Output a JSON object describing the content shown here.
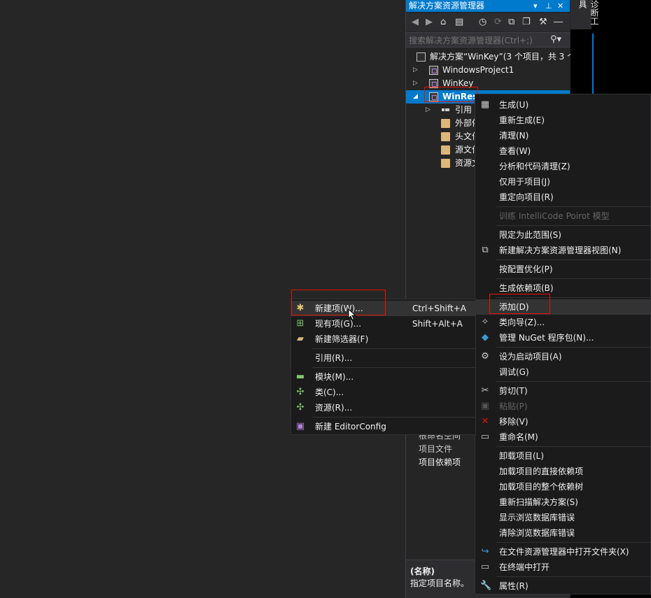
{
  "solution_explorer": {
    "title": "解决方案资源管理器",
    "title_controls": [
      "▾",
      "⊥",
      "✕"
    ],
    "search_placeholder": "搜索解决方案资源管理器(Ctrl+;)",
    "tree": {
      "solution": "解决方案“WinKey”(3 个项目，共 3 个",
      "project1": "WindowsProject1",
      "project2": "WinKey",
      "project3": "WinRes",
      "children": [
        "引用",
        "外部依",
        "头文件",
        "源文件",
        "资源文"
      ]
    },
    "properties": {
      "rows": [
        "根命名空间",
        "项目文件",
        "项目依赖项"
      ],
      "desc_title": "(名称)",
      "desc_text": "指定项目名称。"
    }
  },
  "side_tab": "诊断工具",
  "context_menu": {
    "items": [
      {
        "label": "生成(U)",
        "icon": "build-icon"
      },
      {
        "label": "重新生成(E)"
      },
      {
        "label": "清理(N)"
      },
      {
        "label": "查看(W)"
      },
      {
        "label": "分析和代码清理(Z)"
      },
      {
        "label": "仅用于项目(J)"
      },
      {
        "label": "重定向项目(R)"
      },
      {
        "label": "训练 IntelliCode Poirot 模型",
        "disabled": true
      },
      {
        "label": "限定为此范围(S)"
      },
      {
        "label": "新建解决方案资源管理器视图(N)",
        "icon": "new-view-icon"
      },
      {
        "label": "按配置优化(P)"
      },
      {
        "label": "生成依赖项(B)"
      },
      {
        "label": "添加(D)"
      },
      {
        "label": "类向导(Z)...",
        "icon": "class-wizard-icon"
      },
      {
        "label": "管理 NuGet 程序包(N)...",
        "icon": "nuget-icon"
      },
      {
        "label": "设为启动项目(A)",
        "icon": "gear-icon"
      },
      {
        "label": "调试(G)"
      },
      {
        "label": "剪切(T)",
        "icon": "scissors-icon"
      },
      {
        "label": "粘贴(P)",
        "icon": "paste-icon",
        "disabled": true
      },
      {
        "label": "移除(V)",
        "icon": "remove-icon"
      },
      {
        "label": "重命名(M)",
        "icon": "rename-icon"
      },
      {
        "label": "卸载项目(L)"
      },
      {
        "label": "加载项目的直接依赖项"
      },
      {
        "label": "加载项目的整个依赖树"
      },
      {
        "label": "重新扫描解决方案(S)"
      },
      {
        "label": "显示浏览数据库错误"
      },
      {
        "label": "清除浏览数据库错误"
      },
      {
        "label": "在文件资源管理器中打开文件夹(X)",
        "icon": "open-folder-icon"
      },
      {
        "label": "在终端中打开",
        "icon": "terminal-icon"
      },
      {
        "label": "属性(R)",
        "icon": "wrench-icon"
      }
    ]
  },
  "add_submenu": {
    "items": [
      {
        "label": "新建项(W)...",
        "shortcut": "Ctrl+Shift+A",
        "icon": "new-item-icon"
      },
      {
        "label": "现有项(G)...",
        "shortcut": "Shift+Alt+A",
        "icon": "existing-item-icon"
      },
      {
        "label": "新建筛选器(F)",
        "icon": "new-filter-icon"
      },
      {
        "label": "引用(R)..."
      },
      {
        "label": "模块(M)...",
        "icon": "module-icon"
      },
      {
        "label": "类(C)...",
        "icon": "class-icon"
      },
      {
        "label": "资源(R)...",
        "icon": "resource-icon"
      },
      {
        "label": "新建 EditorConfig",
        "icon": "editorconfig-icon"
      }
    ]
  },
  "colors": {
    "accent": "#007acc",
    "menu_bg": "#1b1b1c",
    "highlight_box": "#e51400",
    "panel_bg": "#252526"
  }
}
